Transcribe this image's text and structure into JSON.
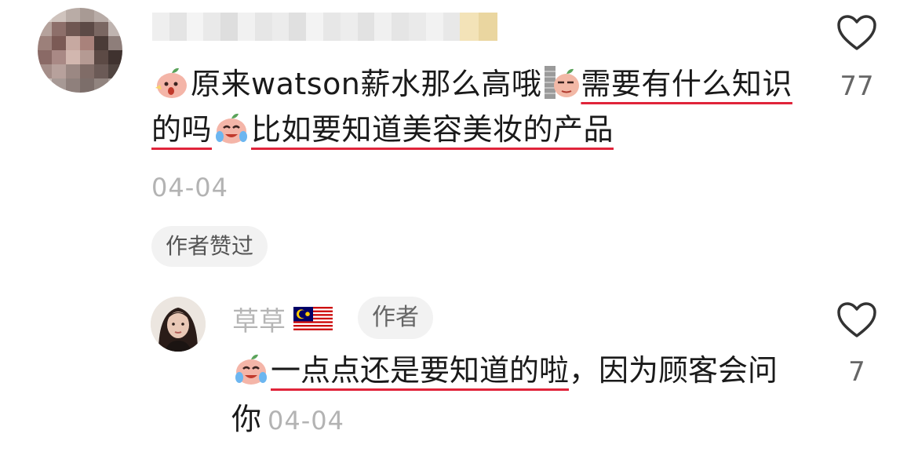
{
  "comment": {
    "emoji_1": "surprised-peach-emoji",
    "text_part1": "原来watson薪水那么高哦",
    "emoji_2": "peeking-peach-emoji",
    "text_part2_underlined": "需要有什么知识的吗",
    "emoji_3": "crying-laugh-peach-emoji",
    "text_part3_underlined": "比如要知道美容美妆的产品",
    "date": "04-04",
    "author_liked_label": "作者赞过",
    "like_count": "77"
  },
  "reply": {
    "username": "草草",
    "flag": "malaysia-flag-icon",
    "author_tag": "作者",
    "emoji": "crying-laugh-peach-emoji",
    "text_underlined": "一点点还是要知道的啦",
    "text_rest": "，因为顾客会问你",
    "date": "04-04",
    "like_count": "7"
  },
  "colors": {
    "underline": "#e0243a",
    "meta_gray": "#b3b3b3",
    "text": "#1a1a1a"
  }
}
